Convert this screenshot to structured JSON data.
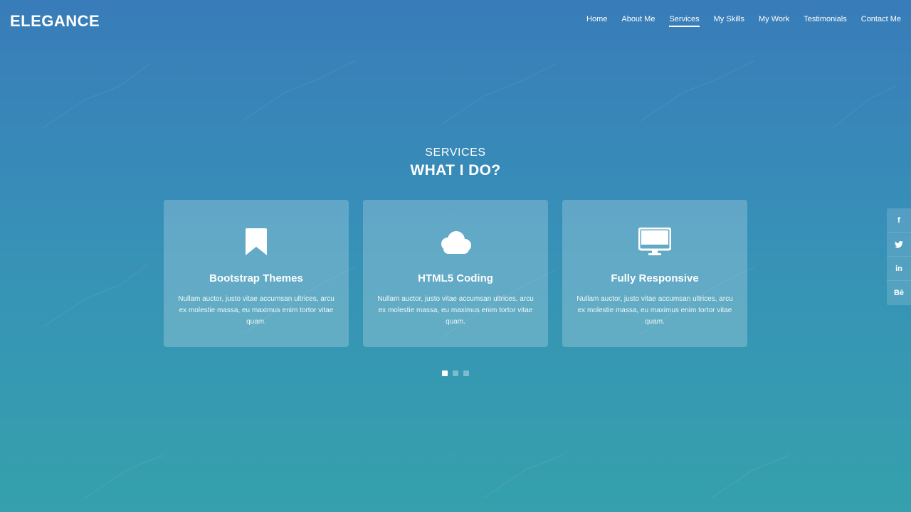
{
  "brand": "ELEGANCE",
  "nav": [
    {
      "label": "Home",
      "active": false
    },
    {
      "label": "About Me",
      "active": false
    },
    {
      "label": "Services",
      "active": true
    },
    {
      "label": "My Skills",
      "active": false
    },
    {
      "label": "My Work",
      "active": false
    },
    {
      "label": "Testimonials",
      "active": false
    },
    {
      "label": "Contact Me",
      "active": false
    }
  ],
  "section": {
    "subtitle": "SERVICES",
    "title": "WHAT I DO?"
  },
  "cards": [
    {
      "icon": "bookmark-icon",
      "title": "Bootstrap Themes",
      "text": "Nullam auctor, justo vitae accumsan ultrices, arcu ex molestie massa, eu maximus enim tortor vitae quam."
    },
    {
      "icon": "cloud-icon",
      "title": "HTML5 Coding",
      "text": "Nullam auctor, justo vitae accumsan ultrices, arcu ex molestie massa, eu maximus enim tortor vitae quam."
    },
    {
      "icon": "monitor-icon",
      "title": "Fully Responsive",
      "text": "Nullam auctor, justo vitae accumsan ultrices, arcu ex molestie massa, eu maximus enim tortor vitae quam."
    }
  ],
  "carousel": {
    "total": 3,
    "active_index": 0
  },
  "social": [
    {
      "icon": "facebook-icon",
      "glyph": "f"
    },
    {
      "icon": "twitter-icon",
      "glyph": "🐦"
    },
    {
      "icon": "linkedin-icon",
      "glyph": "in"
    },
    {
      "icon": "behance-icon",
      "glyph": "Bē"
    }
  ],
  "colors": {
    "background_top": "#387cb9",
    "background_bottom": "#35a1ac",
    "text": "#ffffff"
  }
}
